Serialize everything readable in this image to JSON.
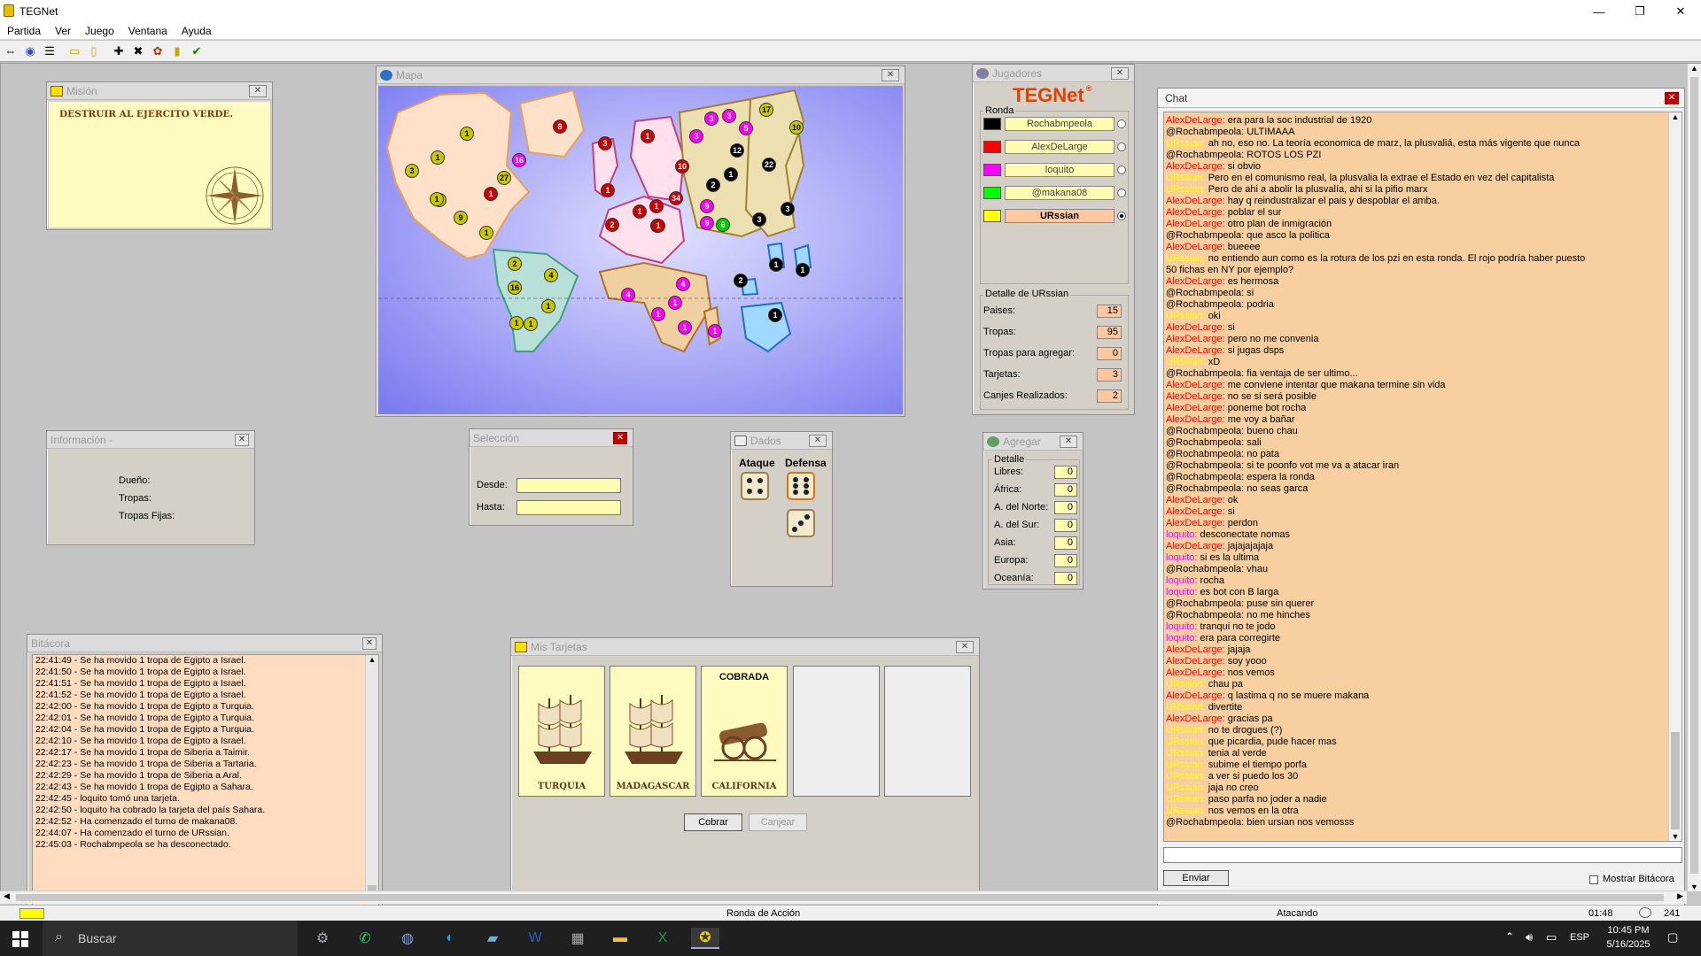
{
  "window": {
    "title": "TEGNet",
    "minimize": "—",
    "maximize": "❐",
    "close": "✕"
  },
  "menu": [
    "Partida",
    "Ver",
    "Juego",
    "Ventana",
    "Ayuda"
  ],
  "toolbar": [
    "connect-icon",
    "globe-icon",
    "list-icon",
    "folder-icon",
    "card-icon",
    "add-icon",
    "attack-icon",
    "regroup-icon",
    "cards-icon",
    "check-icon"
  ],
  "mision": {
    "title": "Misión",
    "text": "DESTRUIR AL EJERCITO VERDE."
  },
  "mapa": {
    "title": "Mapa"
  },
  "map_tokens": [
    {
      "c": "#c8c800",
      "n": "1"
    },
    {
      "c": "#c8c800",
      "n": "1"
    },
    {
      "c": "#c8c800",
      "n": "3"
    },
    {
      "c": "#c8c800",
      "n": "1"
    },
    {
      "c": "#c8c800",
      "n": "27"
    },
    {
      "c": "#c8c800",
      "n": "1"
    },
    {
      "c": "#c8c800",
      "n": "9"
    },
    {
      "c": "#c8c800",
      "n": "1"
    },
    {
      "c": "#cc0000",
      "n": "8"
    },
    {
      "c": "#ff00ff",
      "n": "16"
    },
    {
      "c": "#cc0000",
      "n": "1"
    },
    {
      "c": "#cc0000",
      "n": "3"
    },
    {
      "c": "#cc0000",
      "n": "1"
    },
    {
      "c": "#cc0000",
      "n": "1"
    },
    {
      "c": "#cc0000",
      "n": "10"
    },
    {
      "c": "#cc0000",
      "n": "1"
    },
    {
      "c": "#cc0000",
      "n": "34"
    },
    {
      "c": "#cc0000",
      "n": "1"
    },
    {
      "c": "#cc0000",
      "n": "2"
    },
    {
      "c": "#cc0000",
      "n": "1"
    },
    {
      "c": "#cc0000",
      "n": "1"
    },
    {
      "c": "#ff00ff",
      "n": "3"
    },
    {
      "c": "#ff00ff",
      "n": "3"
    },
    {
      "c": "#ff00ff",
      "n": "3"
    },
    {
      "c": "#ff00ff",
      "n": "5"
    },
    {
      "c": "#c8c800",
      "n": "17"
    },
    {
      "c": "#c8c800",
      "n": "10"
    },
    {
      "c": "#000000",
      "n": "12"
    },
    {
      "c": "#000000",
      "n": "22"
    },
    {
      "c": "#000000",
      "n": "1"
    },
    {
      "c": "#000000",
      "n": "2"
    },
    {
      "c": "#ff00ff",
      "n": "9"
    },
    {
      "c": "#ff00ff",
      "n": "9"
    },
    {
      "c": "#00cc00",
      "n": "6"
    },
    {
      "c": "#000000",
      "n": "3"
    },
    {
      "c": "#000000",
      "n": "3"
    },
    {
      "c": "#c8c800",
      "n": "2"
    },
    {
      "c": "#c8c800",
      "n": "4"
    },
    {
      "c": "#c8c800",
      "n": "16"
    },
    {
      "c": "#c8c800",
      "n": "1"
    },
    {
      "c": "#c8c800",
      "n": "1"
    },
    {
      "c": "#c8c800",
      "n": "1"
    },
    {
      "c": "#ff00ff",
      "n": "4"
    },
    {
      "c": "#ff00ff",
      "n": "4"
    },
    {
      "c": "#ff00ff",
      "n": "1"
    },
    {
      "c": "#ff00ff",
      "n": "1"
    },
    {
      "c": "#ff00ff",
      "n": "1"
    },
    {
      "c": "#ff00ff",
      "n": "1"
    },
    {
      "c": "#000000",
      "n": "2"
    },
    {
      "c": "#000000",
      "n": "1"
    },
    {
      "c": "#000000",
      "n": "1"
    },
    {
      "c": "#000000",
      "n": "1"
    }
  ],
  "jugadores": {
    "title": "Jugadores",
    "logo": "TEGNet",
    "logo_mark": "®",
    "ronda_label": "Ronda",
    "players": [
      {
        "name": "Rochabmpeola",
        "color": "#000000",
        "active": false
      },
      {
        "name": "AlexDeLarge",
        "color": "#ff0000",
        "active": false
      },
      {
        "name": "loquito",
        "color": "#ff00ff",
        "active": false
      },
      {
        "name": "@makana08",
        "color": "#00ff00",
        "active": false
      },
      {
        "name": "URssian",
        "color": "#ffff00",
        "active": true
      }
    ],
    "detalle_title": "Detalle de URssian",
    "detalle": [
      {
        "label": "Paises:",
        "value": "15"
      },
      {
        "label": "Tropas:",
        "value": "95"
      },
      {
        "label": "Tropas para agregar:",
        "value": "0"
      },
      {
        "label": "Tarjetas:",
        "value": "3"
      },
      {
        "label": "Canjes Realizados:",
        "value": "2"
      }
    ]
  },
  "informacion": {
    "title": "Información -",
    "dueno": "Dueño:",
    "tropas": "Tropas:",
    "tropas_fijas": "Tropas Fijas:"
  },
  "seleccion": {
    "title": "Selección",
    "desde": "Desde:",
    "hasta": "Hasta:"
  },
  "dados": {
    "title": "Dados",
    "ataque": "Ataque",
    "defensa": "Defensa"
  },
  "agregar": {
    "title": "Agregar",
    "detalle": "Detalle",
    "rows": [
      {
        "label": "Libres:",
        "value": "0"
      },
      {
        "label": "África:",
        "value": "0"
      },
      {
        "label": "A. del Norte:",
        "value": "0"
      },
      {
        "label": "A. del Sur:",
        "value": "0"
      },
      {
        "label": "Asia:",
        "value": "0"
      },
      {
        "label": "Europa:",
        "value": "0"
      },
      {
        "label": "Oceanía:",
        "value": "0"
      }
    ]
  },
  "bitacora": {
    "title": "Bitácora",
    "lines": [
      "22:41:49 - Se ha movido 1 tropa de Egipto a Israel.",
      "22:41:50 - Se ha movido 1 tropa de Egipto a Israel.",
      "22:41:51 - Se ha movido 1 tropa de Egipto a Israel.",
      "22:41:52 - Se ha movido 1 tropa de Egipto a Israel.",
      "22:42:00 - Se ha movido 1 tropa de Egipto a Turquia.",
      "22:42:01 - Se ha movido 1 tropa de Egipto a Turquia.",
      "22:42:04 - Se ha movido 1 tropa de Egipto a Turquia.",
      "22:42:10 - Se ha movido 1 tropa de Egipto a Israel.",
      "22:42:17 - Se ha movido 1 tropa de Siberia a Taimir.",
      "22:42:23 - Se ha movido 1 tropa de Siberia a Tartaria.",
      "22:42:29 - Se ha movido 1 tropa de Siberia a Aral.",
      "22:42:43 - Se ha movido 1 tropa de Egipto a Sahara.",
      "22:42:45 - loquito tomó una tarjeta.",
      "22:42:50 - loquito ha cobrado la tarjeta del país Sahara.",
      "22:42:52 - Ha comenzado el turno de makana08.",
      "22:44:07 - Ha comenzado el turno de URssian.",
      "22:45:03 - Rochabmpeola se ha desconectado."
    ]
  },
  "tarjetas": {
    "title": "Mis Tarjetas",
    "cards": [
      {
        "name": "TURQUIA",
        "status": "",
        "kind": "ship"
      },
      {
        "name": "MADAGASCAR",
        "status": "",
        "kind": "ship"
      },
      {
        "name": "CALIFORNIA",
        "status": "COBRADA",
        "kind": "cannon"
      }
    ],
    "cobrar": "Cobrar",
    "canjear": "Canjear"
  },
  "chat": {
    "title": "Chat",
    "send": "Enviar",
    "mostrar": "Mostrar Bitácora",
    "colors": {
      "AlexDeLarge": "#ff0000",
      "URssian": "#ffff00",
      "loquito": "#ff00ff",
      "@Rochabmpeola": "#000000"
    },
    "messages": [
      {
        "u": "AlexDeLarge",
        "t": "era para la soc industrial de 1920"
      },
      {
        "u": "@Rochabmpeola",
        "t": "ULTIMAAA"
      },
      {
        "u": "URssian",
        "t": "ah no, eso no. La teoría economica de marz, la plusvaliá, esta más vigente que nunca"
      },
      {
        "u": "@Rochabmpeola",
        "t": "ROTOS LOS PZI"
      },
      {
        "u": "AlexDeLarge",
        "t": "si obvio"
      },
      {
        "u": "URssian",
        "t": "Pero en el comunismo real, la plusvalia la extrae el Estado en vez del capitalista"
      },
      {
        "u": "URssian",
        "t": "Pero de ahi a abolir la plusvalía, ahi si la pifio marx"
      },
      {
        "u": "AlexDeLarge",
        "t": "hay q reindustralizar el pais y despoblar el amba."
      },
      {
        "u": "AlexDeLarge",
        "t": "poblar el sur"
      },
      {
        "u": "AlexDeLarge",
        "t": "otro plan de inmigración"
      },
      {
        "u": "@Rochabmpeola",
        "t": "que asco la politica"
      },
      {
        "u": "AlexDeLarge",
        "t": "bueeee"
      },
      {
        "u": "URssian",
        "t": "no entiendo aun como es la rotura de los pzi en esta ronda. El rojo podría haber puesto"
      },
      {
        "u": "",
        "t": "50 fichas en  NY por ejemplo?"
      },
      {
        "u": "AlexDeLarge",
        "t": "es hermosa"
      },
      {
        "u": "@Rochabmpeola",
        "t": "si"
      },
      {
        "u": "@Rochabmpeola",
        "t": "podria"
      },
      {
        "u": "URssian",
        "t": "oki"
      },
      {
        "u": "AlexDeLarge",
        "t": "si"
      },
      {
        "u": "AlexDeLarge",
        "t": "pero no me convenia"
      },
      {
        "u": "AlexDeLarge",
        "t": "si jugas dsps"
      },
      {
        "u": "URssian",
        "t": "xD"
      },
      {
        "u": "@Rochabmpeola",
        "t": "fia ventaja de ser ultimo..."
      },
      {
        "u": "AlexDeLarge",
        "t": "me conviene intentar que makana termine sin vida"
      },
      {
        "u": "AlexDeLarge",
        "t": "no se si será posible"
      },
      {
        "u": "AlexDeLarge",
        "t": "poneme bot rocha"
      },
      {
        "u": "AlexDeLarge",
        "t": "me voy a bañar"
      },
      {
        "u": "@Rochabmpeola",
        "t": "bueno chau"
      },
      {
        "u": "@Rochabmpeola",
        "t": "sali"
      },
      {
        "u": "@Rochabmpeola",
        "t": "no pata"
      },
      {
        "u": "@Rochabmpeola",
        "t": "si te poonfo vot me va a atacar iran"
      },
      {
        "u": "@Rochabmpeola",
        "t": "espera la ronda"
      },
      {
        "u": "@Rochabmpeola",
        "t": "no seas garca"
      },
      {
        "u": "AlexDeLarge",
        "t": "ok"
      },
      {
        "u": "AlexDeLarge",
        "t": "si"
      },
      {
        "u": "AlexDeLarge",
        "t": "perdon"
      },
      {
        "u": "loquito",
        "t": "desconectate nomas"
      },
      {
        "u": "AlexDeLarge",
        "t": "jajajajajaja"
      },
      {
        "u": "loquito",
        "t": "si es la ultima"
      },
      {
        "u": "@Rochabmpeola",
        "t": "vhau"
      },
      {
        "u": "loquito",
        "t": "rocha"
      },
      {
        "u": "loquito",
        "t": "es bot con B larga"
      },
      {
        "u": "@Rochabmpeola",
        "t": "puse sin querer"
      },
      {
        "u": "@Rochabmpeola",
        "t": "no me hinches"
      },
      {
        "u": "loquito",
        "t": "tranqui no te jodo"
      },
      {
        "u": "loquito",
        "t": "era para corregirte"
      },
      {
        "u": "AlexDeLarge",
        "t": "jajaja"
      },
      {
        "u": "AlexDeLarge",
        "t": "soy yooo"
      },
      {
        "u": "AlexDeLarge",
        "t": "nos vemos"
      },
      {
        "u": "URssian",
        "t": "chau pa"
      },
      {
        "u": "AlexDeLarge",
        "t": "q lastima q no se muere makana"
      },
      {
        "u": "URssian",
        "t": "divertite"
      },
      {
        "u": "AlexDeLarge",
        "t": "gracias pa"
      },
      {
        "u": "URssian",
        "t": "no te drogues (?)"
      },
      {
        "u": "URssian",
        "t": "que picardia, pude hacer mas"
      },
      {
        "u": "URssian",
        "t": "tenia al verde"
      },
      {
        "u": "URssian",
        "t": "subime el tiempo porfa"
      },
      {
        "u": "URssian",
        "t": "a ver si puedo los 30"
      },
      {
        "u": "URssian",
        "t": "jaja no creo"
      },
      {
        "u": "URssian",
        "t": "paso parfa no joder a nadie"
      },
      {
        "u": "URssian",
        "t": "nos vemos en la otra"
      },
      {
        "u": "@Rochabmpeola",
        "t": "bien ursian nos vemosss"
      }
    ]
  },
  "status": {
    "ronda": "Ronda de Acción",
    "estado": "Atacando",
    "time": "01:48",
    "count": "241"
  },
  "taskbar": {
    "search": "Buscar",
    "lang": "ESP",
    "time": "10:45 PM",
    "date": "5/16/2025",
    "apps": [
      "tasks-icon",
      "whatsapp-icon",
      "app-icon",
      "edge-icon",
      "notes-icon",
      "word-icon",
      "calculator-icon",
      "explorer-icon",
      "excel-icon",
      "teg-icon"
    ]
  }
}
